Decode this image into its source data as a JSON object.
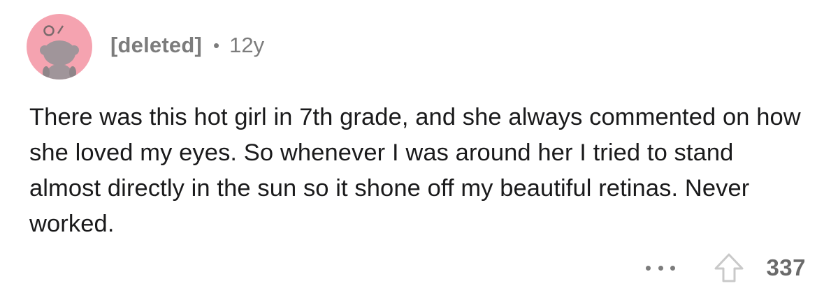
{
  "comment": {
    "author": "[deleted]",
    "separator": "•",
    "age": "12y",
    "avatar_icon": "snoo-avatar-icon",
    "avatar_bg": "#f5a3b0",
    "text": "There was this hot girl in 7th grade, and she always commented on how she loved my eyes. So whenever I was around her I tried to stand almost directly in the sun so it shone off my beautiful retinas. Never worked.",
    "more_icon": "more-options-icon",
    "upvote_icon": "upvote-arrow-icon",
    "score": "337"
  }
}
